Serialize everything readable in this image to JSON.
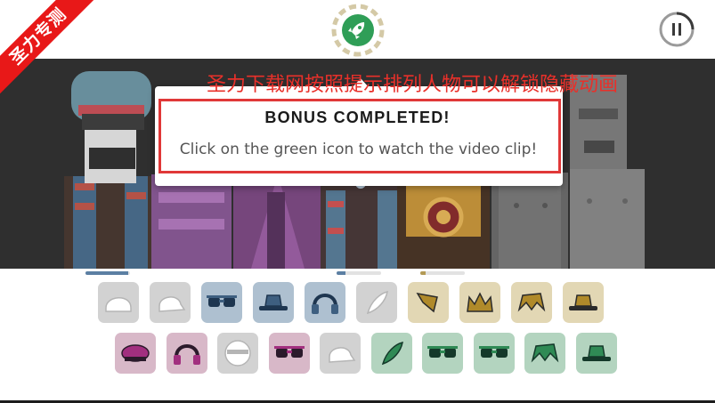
{
  "watermark": {
    "corner_text": "圣力专测",
    "overlay_text": "圣力下载网按照提示排列人物可以解锁隐藏动画"
  },
  "topbar": {
    "bonus_icon": "rocket-icon",
    "pause_icon": "pause-icon"
  },
  "dialog": {
    "title": "BONUS COMPLETED!",
    "message": "Click on the green icon to watch the video clip!"
  },
  "colors": {
    "bonus_green": "#2f9e57",
    "gray_tile": "#d2d2d2",
    "blue_tile": "#aec0d0",
    "gold_tile": "#e2d7b4",
    "purple_tile": "#d8b8c8",
    "green_tile": "#b3d4bf",
    "alert_red": "#e8302a"
  },
  "progress_bars": [
    {
      "fill": 0.95,
      "color": "#5c7fa3"
    },
    {
      "fill": 0.2,
      "color": "#5c7fa3"
    },
    {
      "fill": 0.12,
      "color": "#b39a55"
    }
  ],
  "icon_rows": [
    [
      {
        "name": "white-helmet-icon",
        "tile": "gray"
      },
      {
        "name": "white-cap-icon",
        "tile": "gray"
      },
      {
        "name": "sunglasses-icon",
        "tile": "blue"
      },
      {
        "name": "fedora-hat-icon",
        "tile": "blue"
      },
      {
        "name": "headphones-icon",
        "tile": "blue"
      },
      {
        "name": "white-feather-icon",
        "tile": "gray"
      },
      {
        "name": "gold-scarf-icon",
        "tile": "gold"
      },
      {
        "name": "gold-crown-icon",
        "tile": "gold"
      },
      {
        "name": "gold-hair-icon",
        "tile": "gold"
      },
      {
        "name": "straw-hat-icon",
        "tile": "gold"
      }
    ],
    [
      {
        "name": "purple-beret-icon",
        "tile": "purple"
      },
      {
        "name": "cat-ears-headphones-icon",
        "tile": "purple"
      },
      {
        "name": "white-mask-icon",
        "tile": "gray"
      },
      {
        "name": "purple-glasses-icon",
        "tile": "purple"
      },
      {
        "name": "white-baseball-cap-icon",
        "tile": "gray"
      },
      {
        "name": "green-leaf-icon",
        "tile": "green"
      },
      {
        "name": "green-goggles-icon",
        "tile": "green"
      },
      {
        "name": "green-shades-icon",
        "tile": "green"
      },
      {
        "name": "green-hair-icon",
        "tile": "green"
      },
      {
        "name": "green-hat-icon",
        "tile": "green"
      }
    ]
  ]
}
